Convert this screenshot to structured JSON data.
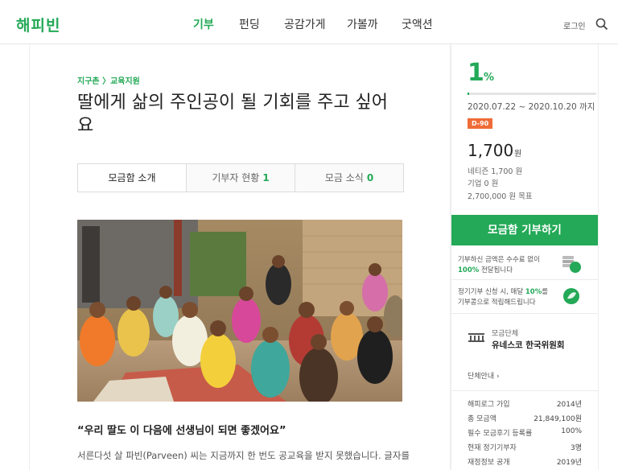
{
  "header": {
    "logo": "해피빈",
    "nav": [
      "기부",
      "펀딩",
      "공감가게",
      "가볼까",
      "굿액션"
    ],
    "active_nav": "기부",
    "login": "로그인"
  },
  "campaign": {
    "breadcrumb": "지구촌 〉교육지원",
    "title": "딸에게 삶의 주인공이 될 기회를 주고 싶어요",
    "tabs": [
      {
        "label": "모금함 소개",
        "count": ""
      },
      {
        "label": "기부자 현황",
        "count": "1"
      },
      {
        "label": "모금 소식",
        "count": "0"
      }
    ],
    "quote": "“우리 딸도 이 다음에 선생님이 되면 좋겠어요”",
    "body_text": "서른다섯 살 파빈(Parveen) 씨는 지금까지 한 번도 공교육을 받지 못했습니다. 글자를"
  },
  "sidebar": {
    "percent": "1",
    "percent_sign": "%",
    "progress_fraction": 0.01,
    "period": "2020.07.22 ~ 2020.10.20 까지",
    "dday": "D-90",
    "amount": "1,700",
    "amount_unit": "원",
    "netizen": "네티즌 1,700 원",
    "company": "기업 0 원",
    "goal": "2,700,000 원 목표",
    "donate_label": "모금함 기부하기",
    "info1_pre": "기부하신 금액은 수수료 없이",
    "info1_strong": "100%",
    "info1_post": " 전달됩니다",
    "info2_pre": "정기기부 신청 시, 매달 ",
    "info2_strong": "10%",
    "info2_post": "를",
    "info2_line2": "기부콩으로 적립해드립니다",
    "org_label": "모금단체",
    "org_name": "유네스코 한국위원회",
    "org_link": "단체안내 ›",
    "stats": [
      {
        "label": "해피로그 가입",
        "value": "2014년"
      },
      {
        "label": "총 모금액",
        "value": "21,849,100원"
      },
      {
        "label": "필수 모금후기 등록률",
        "value": "100%"
      },
      {
        "label": "현재 정기기부자",
        "value": "3명"
      },
      {
        "label": "재정정보 공개",
        "value": "2019년"
      }
    ]
  },
  "colors": {
    "brand": "#23a957",
    "dday": "#ef6c37"
  },
  "icons": [
    "search-icon",
    "coins-icon",
    "leaf-icon",
    "unesco-logo"
  ]
}
